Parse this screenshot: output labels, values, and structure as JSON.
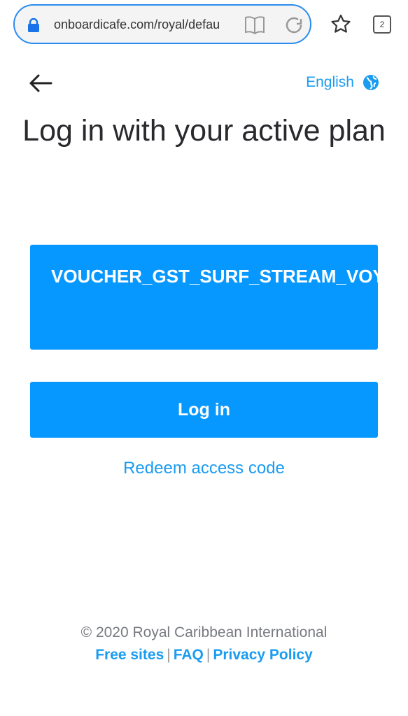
{
  "browser": {
    "url": "onboardicafe.com/royal/defau",
    "tab_count": "2",
    "accent": "#2a8cf0"
  },
  "header": {
    "language": "English"
  },
  "main": {
    "title": "Log in with your active plan",
    "voucher": "VOUCHER_GST_SURF_STREAM_VOYAGE",
    "login_label": "Log in",
    "redeem_label": "Redeem access code",
    "button_color": "#0798ff"
  },
  "footer": {
    "copyright": "© 2020 Royal Caribbean International",
    "links": [
      "Free sites",
      "FAQ",
      "Privacy Policy"
    ],
    "separator": "|"
  }
}
